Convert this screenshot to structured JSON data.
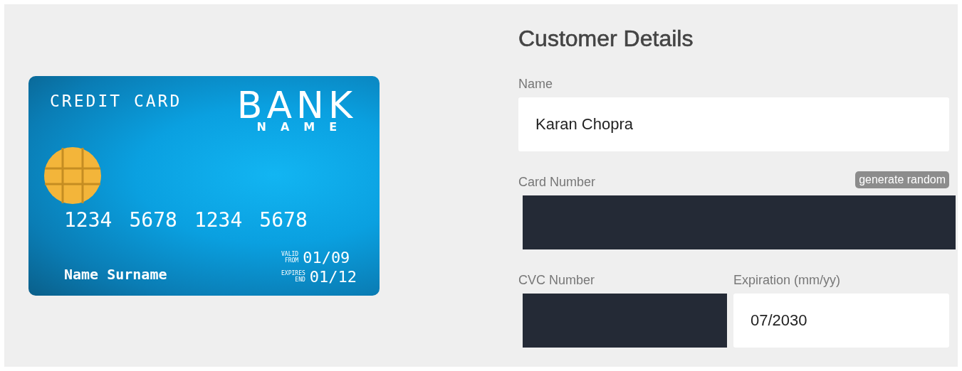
{
  "card": {
    "heading": "CREDIT CARD",
    "bank": "BANK",
    "bank_sub": "NAME",
    "number": [
      "1234",
      "5678",
      "1234",
      "5678"
    ],
    "holder": "Name Surname",
    "dates": [
      {
        "caption_top": "VALID",
        "caption_bottom": "FROM",
        "value": "01/09"
      },
      {
        "caption_top": "EXPIRES",
        "caption_bottom": "END",
        "value": "01/12"
      }
    ]
  },
  "form": {
    "title": "Customer Details",
    "generate_button": "generate random",
    "rows": [
      [
        {
          "label": "Name",
          "kind": "text",
          "value": "Karan Chopra"
        }
      ],
      [
        {
          "label": "Card Number",
          "kind": "redacted"
        }
      ],
      [
        {
          "label": "CVC Number",
          "kind": "redacted"
        },
        {
          "label": "Expiration (mm/yy)",
          "kind": "text",
          "value": "07/2030"
        }
      ]
    ]
  }
}
